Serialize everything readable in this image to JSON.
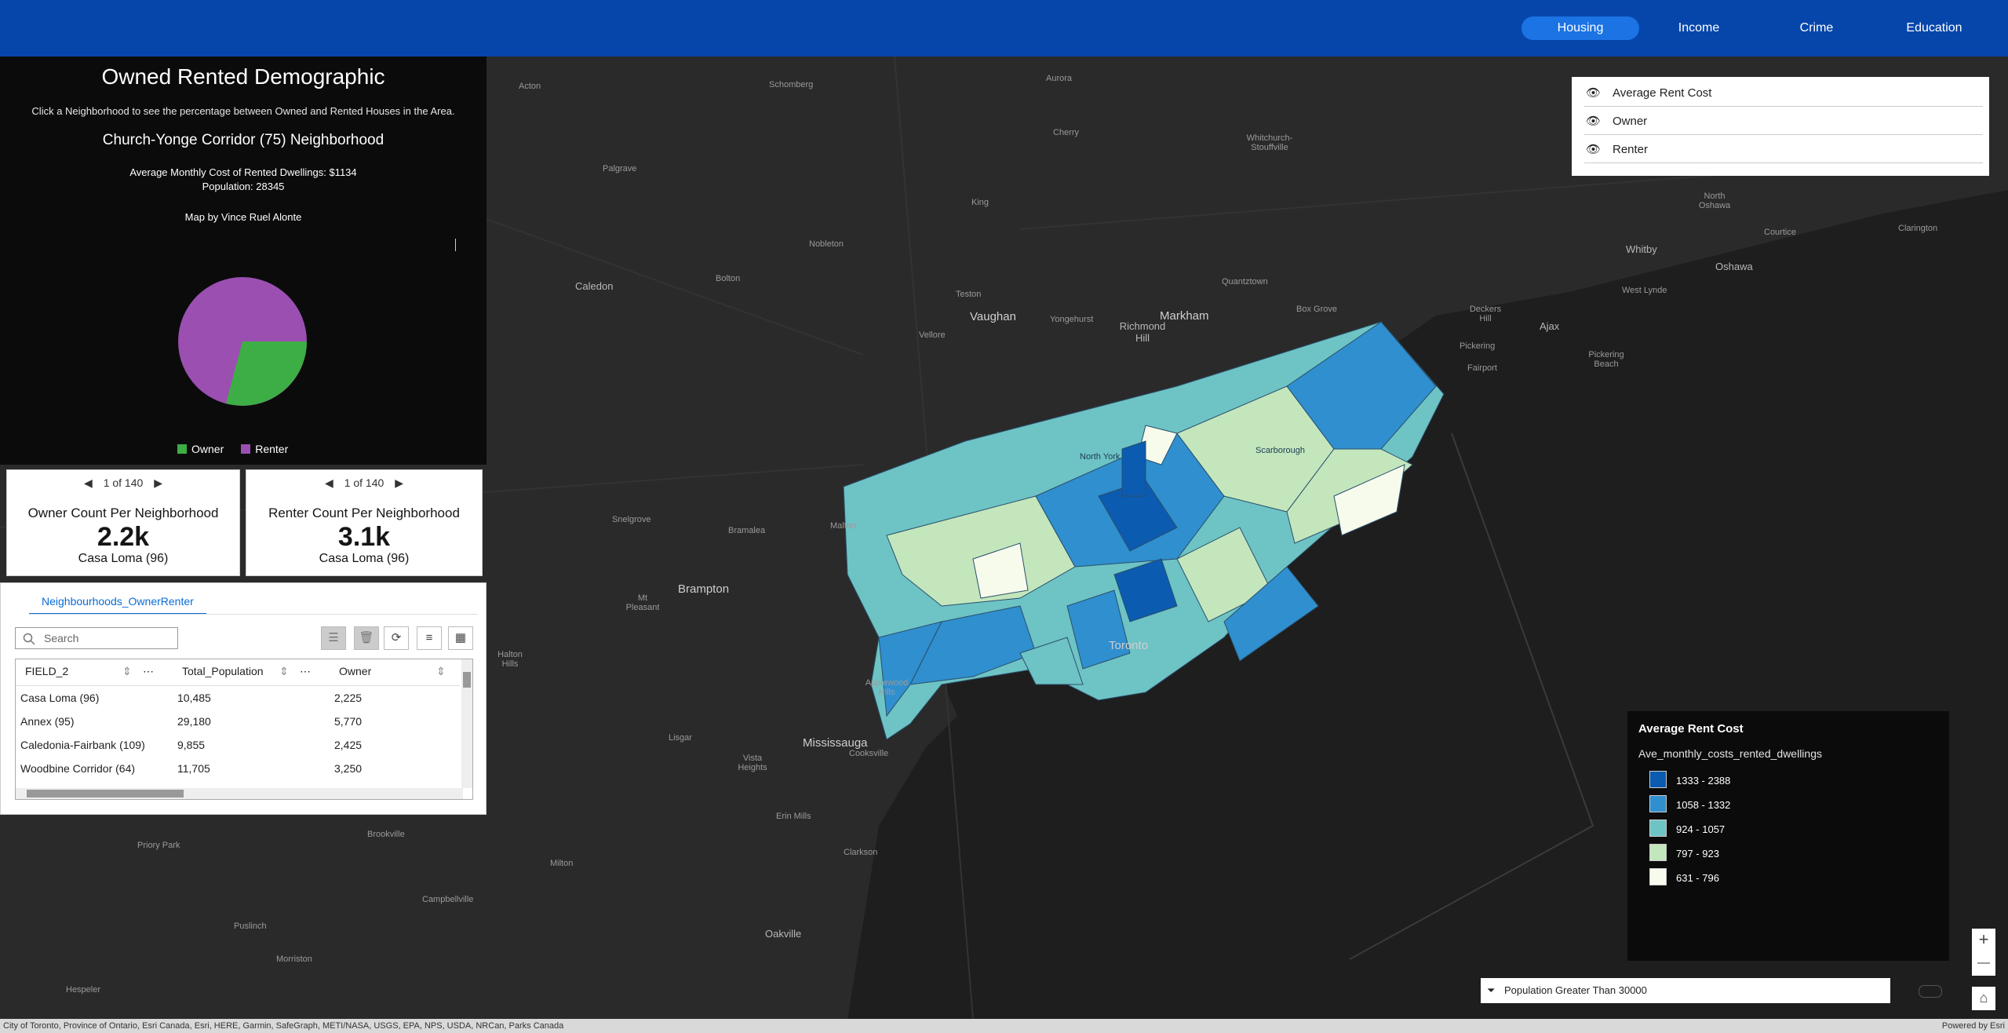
{
  "nav": {
    "items": [
      {
        "label": "Housing",
        "active": true
      },
      {
        "label": "Income",
        "active": false
      },
      {
        "label": "Crime",
        "active": false
      },
      {
        "label": "Education",
        "active": false
      }
    ]
  },
  "left_panel": {
    "title": "Owned Rented Demographic",
    "subtitle": "Click a Neighborhood to see the percentage between Owned and Rented Houses in the Area.",
    "neighborhood": "Church-Yonge Corridor (75)  Neighborhood",
    "avg_cost": "Average Monthly Cost of Rented Dwellings: $1134",
    "population": "Population: 28345",
    "credit": "Map by Vince Ruel Alonte",
    "pie": {
      "slices": [
        {
          "label": "Owner",
          "color": "#3dae45"
        },
        {
          "label": "Renter",
          "color": "#9b4fb1"
        }
      ]
    }
  },
  "cards": {
    "owner": {
      "pager": "1 of 140",
      "title": "Owner Count Per Neighborhood",
      "value": "2.2k",
      "sub": "Casa Loma (96)"
    },
    "renter": {
      "pager": "1 of 140",
      "title": "Renter Count Per Neighborhood",
      "value": "3.1k",
      "sub": "Casa Loma (96)"
    }
  },
  "table": {
    "tab": "Neighbourhoods_OwnerRenter",
    "search_placeholder": "Search",
    "columns": [
      "FIELD_2",
      "Total_Population",
      "Owner"
    ],
    "rows": [
      [
        "Casa Loma (96)",
        "10,485",
        "2,225"
      ],
      [
        "Annex (95)",
        "29,180",
        "5,770"
      ],
      [
        "Caledonia-Fairbank (109)",
        "9,855",
        "2,425"
      ],
      [
        "Woodbine Corridor (64)",
        "11,705",
        "3,250"
      ]
    ]
  },
  "layers": {
    "items": [
      "Average Rent Cost",
      "Owner",
      "Renter"
    ]
  },
  "legend": {
    "title": "Average Rent Cost",
    "field": "Ave_monthly_costs_rented_dwellings",
    "classes": [
      {
        "label": "1333 - 2388",
        "color": "#0b5bb0"
      },
      {
        "label": "1058 - 1332",
        "color": "#2f8fcf"
      },
      {
        "label": "924 - 1057",
        "color": "#6ec3c5"
      },
      {
        "label": "797 - 923",
        "color": "#c4e6bd"
      },
      {
        "label": "631 - 796",
        "color": "#f7fbec"
      }
    ]
  },
  "filter": {
    "label": "Population Greater Than 30000"
  },
  "zoom": {
    "in": "+",
    "out": "—"
  },
  "attribution": {
    "left": "City of Toronto, Province of Ontario, Esri Canada, Esri, HERE, Garmin, SafeGraph, METI/NASA, USGS, EPA, NPS, USDA, NRCan, Parks Canada",
    "right": "Powered by Esri"
  },
  "places": [
    "Aurora",
    "Schomberg",
    "Acton",
    "Cherry",
    "King",
    "Whitchurch-Stouffville",
    "Palgrave",
    "Nobleton",
    "Caledon",
    "Bolton",
    "Teston",
    "Vaughan",
    "Yongehurst",
    "Richmond Hill",
    "Markham",
    "Quantztown",
    "Box Grove",
    "North Oshawa",
    "Courtice",
    "Clarington",
    "Whitby",
    "Oshawa",
    "West Lynde",
    "Deckers Hill",
    "Ajax",
    "Pickering",
    "Fairport",
    "Pickering Beach",
    "Vellore",
    "Snelgrove",
    "Bramalea",
    "Malton",
    "Brampton",
    "Mt Pleasant",
    "Halton Hills",
    "Applewood Hills",
    "Toronto",
    "Lisgar",
    "Mississauga",
    "Vista Heights",
    "Cooksville",
    "Erin Mills",
    "Priory Park",
    "Brookville",
    "Milton",
    "Clarkson",
    "Campbellville",
    "Puslinch",
    "Morriston",
    "Oakville",
    "Hespeler",
    "North York",
    "Scarborough"
  ]
}
